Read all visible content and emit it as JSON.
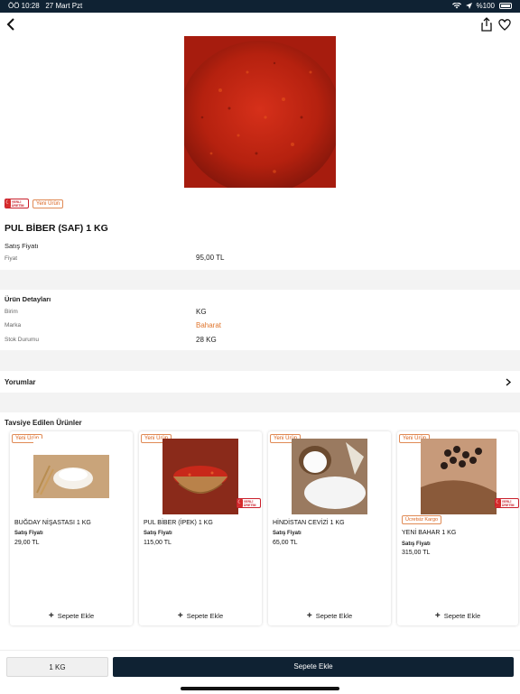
{
  "status_bar": {
    "time": "ÖÖ 10:28",
    "date": "27 Mart Pzt",
    "battery": "%100"
  },
  "product": {
    "title": "PUL BİBER (SAF) 1 KG",
    "badge_local": "YERLİ ÜRETİM",
    "badge_new": "Yeni Ürün",
    "price_section": "Satış Fiyatı",
    "price_label": "Fiyat",
    "price_value": "95,00 TL"
  },
  "details": {
    "heading": "Ürün Detayları",
    "rows": [
      {
        "label": "Birim",
        "value": "KG"
      },
      {
        "label": "Marka",
        "value": "Baharat"
      },
      {
        "label": "Stok Durumu",
        "value": "28 KG"
      }
    ]
  },
  "reviews": {
    "label": "Yorumlar"
  },
  "recommended": {
    "heading": "Tavsiye Edilen Ürünler",
    "items": [
      {
        "badge": "Yeni Ürün",
        "name": "BUĞDAY NİŞASTASI 1 KG",
        "price_label": "Satış Fiyatı",
        "price": "29,00 TL",
        "add": "Sepete Ekle"
      },
      {
        "badge": "Yeni Ürün",
        "name": "PUL BİBER (İPEK) 1 KG",
        "price_label": "Satış Fiyatı",
        "price": "115,00 TL",
        "add": "Sepete Ekle"
      },
      {
        "badge": "Yeni Ürün",
        "name": "HİNDİSTAN CEVİZİ 1 KG",
        "price_label": "Satış Fiyatı",
        "price": "65,00 TL",
        "add": "Sepete Ekle"
      },
      {
        "badge": "Yeni Ürün",
        "cargo": "Ücretsiz Kargo",
        "name": "YENİ BAHAR 1 KG",
        "price_label": "Satış Fiyatı",
        "price": "315,00 TL",
        "add": "Sepete Ekle"
      }
    ]
  },
  "bottom": {
    "quantity": "1 KG",
    "add_to_cart": "Sepete Ekle"
  },
  "colors": {
    "navy": "#0f2233",
    "accent": "#d9601a",
    "brand_link": "#e0762e"
  }
}
